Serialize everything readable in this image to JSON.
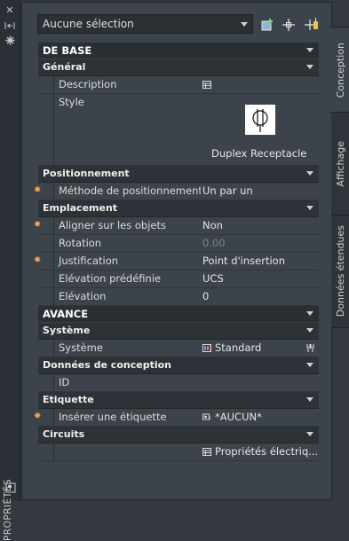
{
  "palette": {
    "title": "PROPRIÉTÉS",
    "tabs": [
      {
        "label": "Conception",
        "active": true
      },
      {
        "label": "Affichage",
        "active": false
      },
      {
        "label": "Données étendues",
        "active": false
      }
    ]
  },
  "toolbar": {
    "selection": "Aucune sélection"
  },
  "sections": {
    "base": "DE BASE",
    "general": "Général",
    "description_label": "Description",
    "style_label": "Style",
    "style_value": "Duplex Receptacle",
    "positionnement": "Positionnement",
    "methode_label": "Méthode de positionnement",
    "methode_value": "Un par un",
    "emplacement": "Emplacement",
    "aligner_label": "Aligner sur les objets",
    "aligner_value": "Non",
    "rotation_label": "Rotation",
    "rotation_value": "0.00",
    "justification_label": "Justification",
    "justification_value": "Point d'insertion",
    "elev_predef_label": "Elévation prédéfinie",
    "elev_predef_value": "UCS",
    "elevation_label": "Elévation",
    "elevation_value": "0",
    "avance": "AVANCE",
    "systeme_header": "Système",
    "systeme_label": "Système",
    "systeme_value": "Standard",
    "donnees_conception": "Données de conception",
    "id_label": "ID",
    "etiquette": "Etiquette",
    "inserer_label": "Insérer une étiquette",
    "inserer_value": "*AUCUN*",
    "circuits": "Circuits",
    "circuits_value": "Propriétés  électriq..."
  },
  "colors": {
    "panel": "#3c434a",
    "header": "#2a2f34",
    "star": "#f0a050"
  }
}
